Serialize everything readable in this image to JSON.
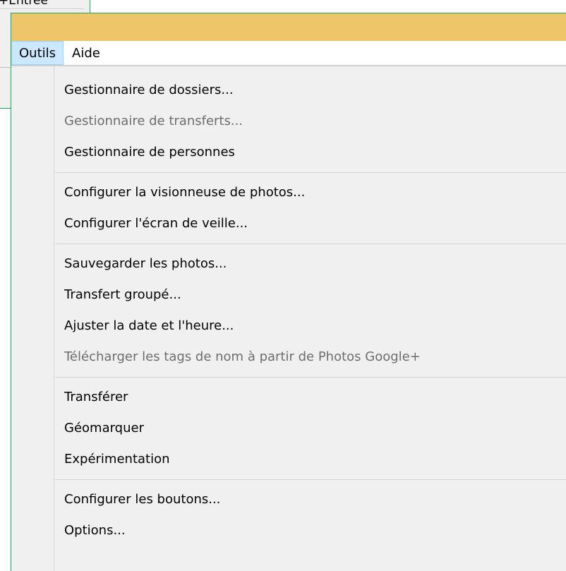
{
  "background_window": {
    "label": "+Entrée"
  },
  "menubar": {
    "items": [
      {
        "label": "Outils",
        "active": true
      },
      {
        "label": "Aide",
        "active": false
      }
    ]
  },
  "menu": {
    "groups": [
      [
        {
          "label": "Gestionnaire de dossiers...",
          "enabled": true
        },
        {
          "label": "Gestionnaire de transferts...",
          "enabled": false
        },
        {
          "label": "Gestionnaire de personnes",
          "enabled": true
        }
      ],
      [
        {
          "label": "Configurer la visionneuse de photos...",
          "enabled": true
        },
        {
          "label": "Configurer l'écran de veille...",
          "enabled": true
        }
      ],
      [
        {
          "label": "Sauvegarder les photos...",
          "enabled": true
        },
        {
          "label": "Transfert groupé...",
          "enabled": true
        },
        {
          "label": "Ajuster la date et l'heure...",
          "enabled": true
        },
        {
          "label": "Télécharger les tags de nom à partir de Photos Google+",
          "enabled": false
        }
      ],
      [
        {
          "label": "Transférer",
          "enabled": true,
          "submenu": true
        },
        {
          "label": "Géomarquer",
          "enabled": true,
          "submenu": true
        },
        {
          "label": "Expérimentation",
          "enabled": true,
          "submenu": true
        }
      ],
      [
        {
          "label": "Configurer les boutons...",
          "enabled": true
        },
        {
          "label": "Options...",
          "enabled": true
        }
      ]
    ]
  },
  "colors": {
    "titlebar": "#efc56a",
    "menu_background": "#f0f0f0",
    "active_menu_highlight": "#cce8ff",
    "window_border": "#1aa85a",
    "disabled_text": "#6d6d6d"
  }
}
